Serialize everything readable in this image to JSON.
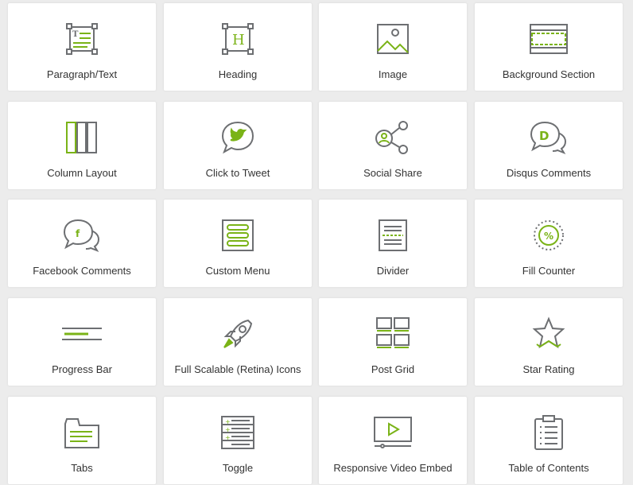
{
  "colors": {
    "accent": "#7ab317",
    "icon_gray": "#6d6f72",
    "tile_bg": "#ffffff",
    "page_bg": "#ececec",
    "text": "#333333"
  },
  "widgets": [
    {
      "label": "Paragraph/Text",
      "icon": "paragraph-text-icon"
    },
    {
      "label": "Heading",
      "icon": "heading-icon"
    },
    {
      "label": "Image",
      "icon": "image-icon"
    },
    {
      "label": "Background Section",
      "icon": "background-section-icon"
    },
    {
      "label": "Column Layout",
      "icon": "column-layout-icon"
    },
    {
      "label": "Click to Tweet",
      "icon": "tweet-bubble-icon"
    },
    {
      "label": "Social Share",
      "icon": "social-share-icon"
    },
    {
      "label": "Disqus Comments",
      "icon": "disqus-bubbles-icon"
    },
    {
      "label": "Facebook Comments",
      "icon": "facebook-bubbles-icon"
    },
    {
      "label": "Custom Menu",
      "icon": "custom-menu-icon"
    },
    {
      "label": "Divider",
      "icon": "divider-icon"
    },
    {
      "label": "Fill Counter",
      "icon": "fill-counter-icon"
    },
    {
      "label": "Progress Bar",
      "icon": "progress-bar-icon"
    },
    {
      "label": "Full Scalable (Retina) Icons",
      "icon": "rocket-icon"
    },
    {
      "label": "Post Grid",
      "icon": "post-grid-icon"
    },
    {
      "label": "Star Rating",
      "icon": "star-icon"
    },
    {
      "label": "Tabs",
      "icon": "tabs-icon"
    },
    {
      "label": "Toggle",
      "icon": "toggle-icon"
    },
    {
      "label": "Responsive Video Embed",
      "icon": "video-embed-icon"
    },
    {
      "label": "Table of Contents",
      "icon": "table-of-contents-icon"
    }
  ]
}
